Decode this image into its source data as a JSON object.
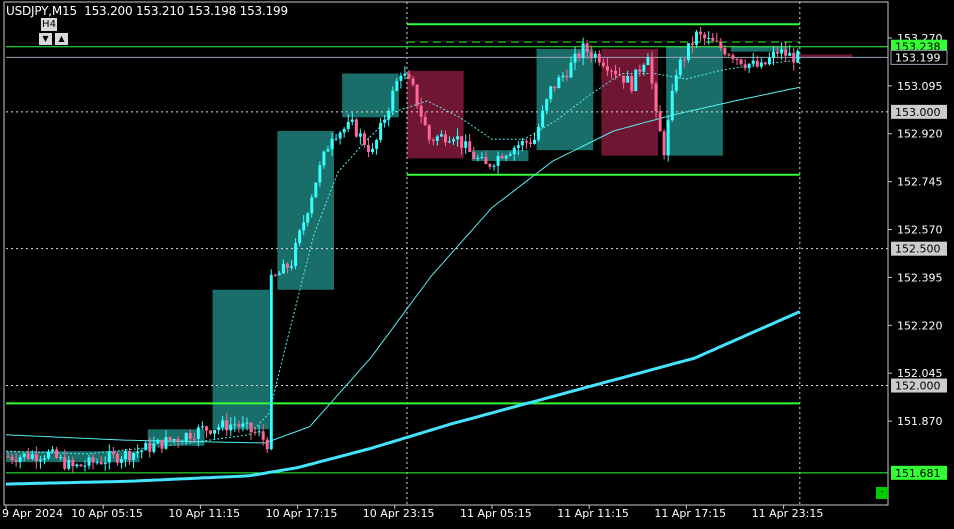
{
  "header": {
    "symbol": "USDJPY,M15",
    "quote": "153.200 153.210 153.198 153.199",
    "higher_tf_label": "H4",
    "arrow_down": "▼",
    "arrow_up": "▲",
    "corner_button": "-"
  },
  "colors": {
    "background": "#000000",
    "frame": "#c8c8c8",
    "bull_box": "#1a6e6a",
    "bear_box": "#6e1632",
    "candle_bull": "#33ffff",
    "candle_bear": "#ff6699",
    "level_line": "#33ff33",
    "ma_fast": "#55eeee",
    "ma_slow": "#55eeee",
    "ma_long": "#44e4ff",
    "dotted": "#dddddd",
    "label_price_bg": "#cccccc",
    "label_level_bg": "#33ff33"
  },
  "chart_data": {
    "type": "candlestick",
    "symbol": "USDJPY",
    "timeframe": "M15",
    "ylim": [
      151.6,
      153.31
    ],
    "y_ticks": [
      153.27,
      153.095,
      152.92,
      152.745,
      152.57,
      152.395,
      152.22,
      152.045,
      151.87
    ],
    "y_tick_labels": [
      "153.270",
      "153.095",
      "152.920",
      "152.745",
      "152.570",
      "152.395",
      "152.220",
      "152.045",
      "151.870"
    ],
    "x_tick_labels": [
      "9 Apr 2024",
      "10 Apr 05:15",
      "10 Apr 11:15",
      "10 Apr 17:15",
      "10 Apr 23:15",
      "11 Apr 05:15",
      "11 Apr 11:15",
      "11 Apr 17:15",
      "11 Apr 23:15"
    ],
    "x_tick_index": [
      0,
      24,
      48,
      72,
      96,
      120,
      144,
      168,
      192
    ],
    "n_bars": 196,
    "current_price": 153.199,
    "current_price_label": "153.199",
    "price_labels": [
      {
        "value": 153.238,
        "text": "153.238",
        "style": "level"
      },
      {
        "value": 153.0,
        "text": "153.000",
        "style": "round"
      },
      {
        "value": 152.5,
        "text": "152.500",
        "style": "round"
      },
      {
        "value": 152.0,
        "text": "152.000",
        "style": "round"
      },
      {
        "value": 151.681,
        "text": "151.681",
        "style": "level"
      }
    ],
    "horizontal_levels": [
      {
        "value": 153.32,
        "from": 99,
        "to": 196,
        "style": "solid"
      },
      {
        "value": 153.238,
        "from": 0,
        "to": 222,
        "style": "solid-thin"
      },
      {
        "value": 153.255,
        "from": 99,
        "to": 196,
        "style": "dashed"
      },
      {
        "value": 152.77,
        "from": 99,
        "to": 196,
        "style": "solid"
      },
      {
        "value": 151.935,
        "from": 0,
        "to": 196,
        "style": "solid"
      },
      {
        "value": 151.681,
        "from": 0,
        "to": 222,
        "style": "solid-thin"
      }
    ],
    "round_levels": [
      153.0,
      152.5,
      152.0
    ],
    "vertical_separators": [
      99,
      196
    ],
    "h4_boxes": [
      {
        "start": 0,
        "end": 33,
        "open": 151.72,
        "close": 151.76,
        "dir": "bull"
      },
      {
        "start": 35,
        "end": 49,
        "open": 151.78,
        "close": 151.84,
        "dir": "bull"
      },
      {
        "start": 51,
        "end": 65,
        "open": 151.84,
        "close": 152.35,
        "dir": "bull"
      },
      {
        "start": 67,
        "end": 81,
        "open": 152.35,
        "close": 152.93,
        "dir": "bull"
      },
      {
        "start": 83,
        "end": 97,
        "open": 152.98,
        "close": 153.14,
        "dir": "bull"
      },
      {
        "start": 99,
        "end": 113,
        "open": 153.15,
        "close": 152.83,
        "dir": "bear"
      },
      {
        "start": 115,
        "end": 129,
        "open": 152.82,
        "close": 152.86,
        "dir": "bull"
      },
      {
        "start": 131,
        "end": 145,
        "open": 152.86,
        "close": 153.23,
        "dir": "bull"
      },
      {
        "start": 147,
        "end": 161,
        "open": 153.23,
        "close": 152.84,
        "dir": "bear"
      },
      {
        "start": 163,
        "end": 177,
        "open": 152.84,
        "close": 153.24,
        "dir": "bull"
      },
      {
        "start": 179,
        "end": 193,
        "open": 153.24,
        "close": 153.22,
        "dir": "bull"
      },
      {
        "start": 195,
        "end": 209,
        "open": 153.21,
        "close": 153.2,
        "dir": "bear"
      }
    ],
    "close_path": [
      [
        0,
        151.74
      ],
      [
        10,
        151.75
      ],
      [
        16,
        151.7
      ],
      [
        24,
        151.73
      ],
      [
        32,
        151.76
      ],
      [
        40,
        151.8
      ],
      [
        48,
        151.84
      ],
      [
        56,
        151.86
      ],
      [
        62,
        151.82
      ],
      [
        64,
        151.79
      ],
      [
        65,
        152.38
      ],
      [
        70,
        152.45
      ],
      [
        76,
        152.75
      ],
      [
        80,
        152.92
      ],
      [
        85,
        152.95
      ],
      [
        90,
        152.85
      ],
      [
        93,
        152.98
      ],
      [
        97,
        153.15
      ],
      [
        100,
        153.08
      ],
      [
        104,
        152.9
      ],
      [
        110,
        152.92
      ],
      [
        114,
        152.85
      ],
      [
        118,
        152.8
      ],
      [
        122,
        152.85
      ],
      [
        126,
        152.88
      ],
      [
        130,
        152.9
      ],
      [
        134,
        153.08
      ],
      [
        138,
        153.15
      ],
      [
        142,
        153.23
      ],
      [
        146,
        153.2
      ],
      [
        150,
        153.15
      ],
      [
        154,
        153.1
      ],
      [
        158,
        153.22
      ],
      [
        160,
        152.98
      ],
      [
        162,
        152.86
      ],
      [
        165,
        153.15
      ],
      [
        170,
        153.28
      ],
      [
        174,
        153.25
      ],
      [
        178,
        153.22
      ],
      [
        182,
        153.18
      ],
      [
        186,
        153.16
      ],
      [
        190,
        153.22
      ],
      [
        194,
        153.2
      ],
      [
        195,
        153.199
      ]
    ],
    "ma_fast_path": [
      [
        0,
        151.76
      ],
      [
        20,
        151.75
      ],
      [
        40,
        151.78
      ],
      [
        60,
        151.82
      ],
      [
        65,
        151.9
      ],
      [
        70,
        152.2
      ],
      [
        76,
        152.55
      ],
      [
        82,
        152.78
      ],
      [
        88,
        152.88
      ],
      [
        96,
        153.0
      ],
      [
        104,
        153.04
      ],
      [
        112,
        152.98
      ],
      [
        120,
        152.9
      ],
      [
        128,
        152.9
      ],
      [
        136,
        152.97
      ],
      [
        144,
        153.06
      ],
      [
        152,
        153.14
      ],
      [
        160,
        153.14
      ],
      [
        168,
        153.12
      ],
      [
        176,
        153.15
      ],
      [
        184,
        153.17
      ],
      [
        196,
        153.19
      ]
    ],
    "ma_slow_path": [
      [
        0,
        151.82
      ],
      [
        30,
        151.8
      ],
      [
        64,
        151.79
      ],
      [
        75,
        151.85
      ],
      [
        90,
        152.1
      ],
      [
        105,
        152.4
      ],
      [
        120,
        152.65
      ],
      [
        135,
        152.82
      ],
      [
        150,
        152.93
      ],
      [
        165,
        152.99
      ],
      [
        180,
        153.04
      ],
      [
        196,
        153.09
      ]
    ],
    "ma_long_path": [
      [
        0,
        151.64
      ],
      [
        30,
        151.65
      ],
      [
        60,
        151.67
      ],
      [
        72,
        151.7
      ],
      [
        90,
        151.77
      ],
      [
        110,
        151.86
      ],
      [
        130,
        151.94
      ],
      [
        150,
        152.02
      ],
      [
        170,
        152.1
      ],
      [
        196,
        152.27
      ]
    ]
  }
}
